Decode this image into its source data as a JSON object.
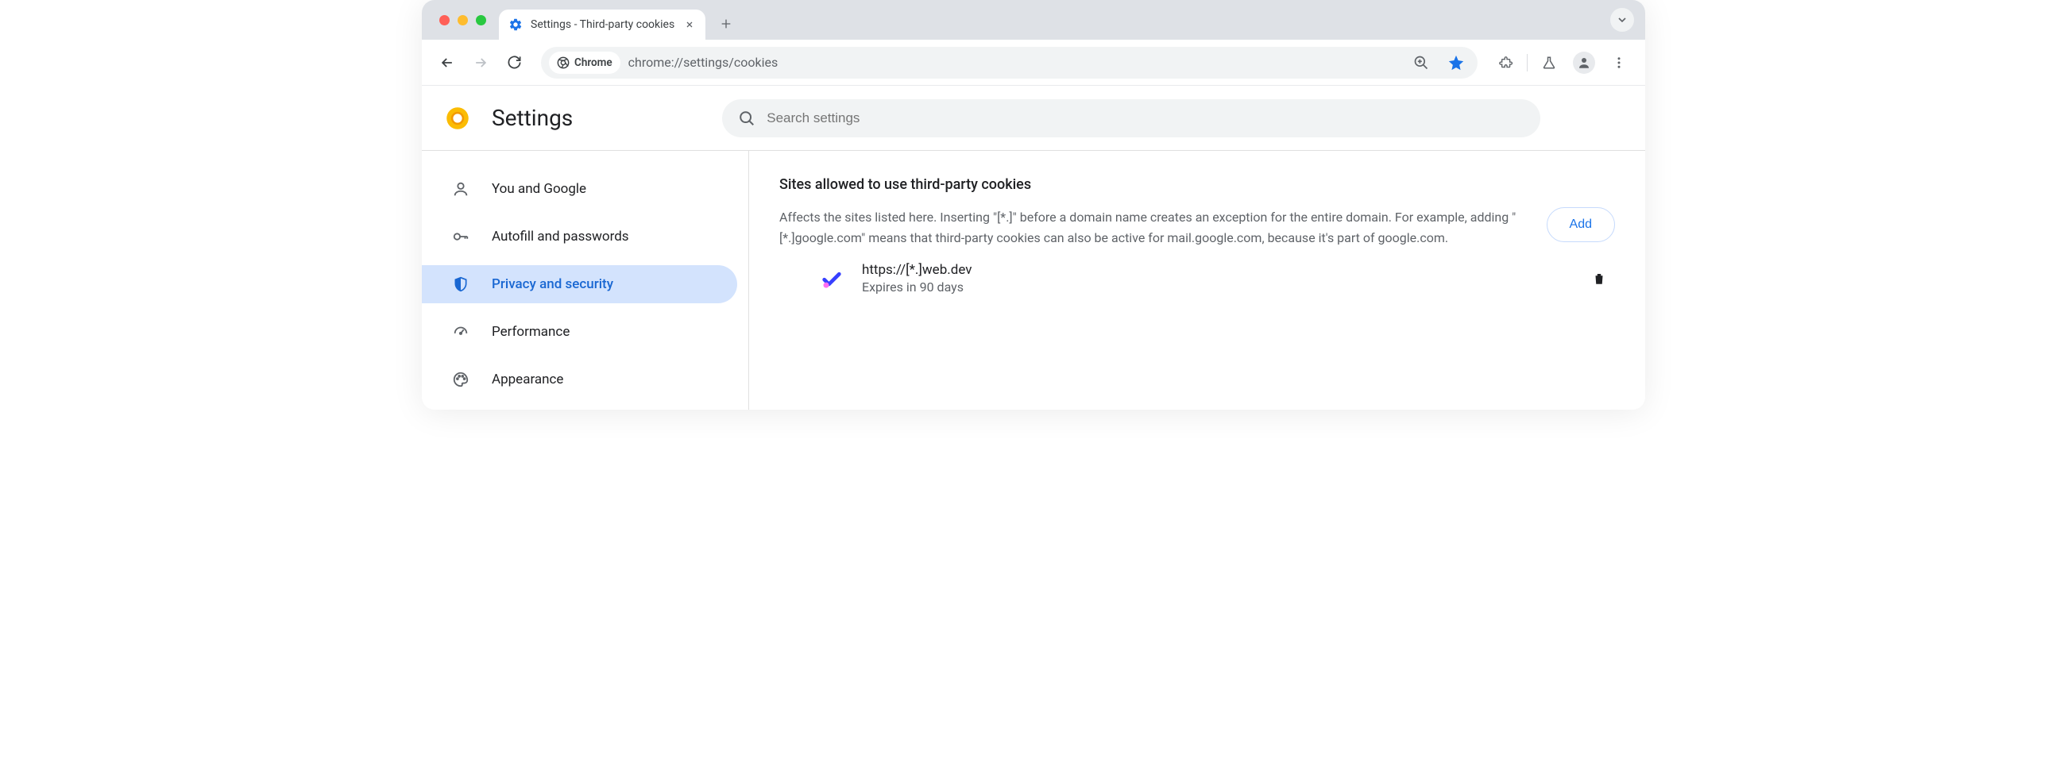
{
  "tab": {
    "title": "Settings - Third-party cookies"
  },
  "omnibox": {
    "chip_label": "Chrome",
    "url": "chrome://settings/cookies"
  },
  "header": {
    "title": "Settings",
    "search_placeholder": "Search settings"
  },
  "sidebar": {
    "items": [
      {
        "label": "You and Google"
      },
      {
        "label": "Autofill and passwords"
      },
      {
        "label": "Privacy and security"
      },
      {
        "label": "Performance"
      },
      {
        "label": "Appearance"
      }
    ]
  },
  "main": {
    "section_title": "Sites allowed to use third-party cookies",
    "section_desc": "Affects the sites listed here. Inserting \"[*.]\" before a domain name creates an exception for the entire domain. For example, adding \"[*.]google.com\" means that third-party cookies can also be active for mail.google.com, because it's part of google.com.",
    "add_label": "Add",
    "site": {
      "url": "https://[*.]web.dev",
      "expires": "Expires in 90 days"
    }
  }
}
